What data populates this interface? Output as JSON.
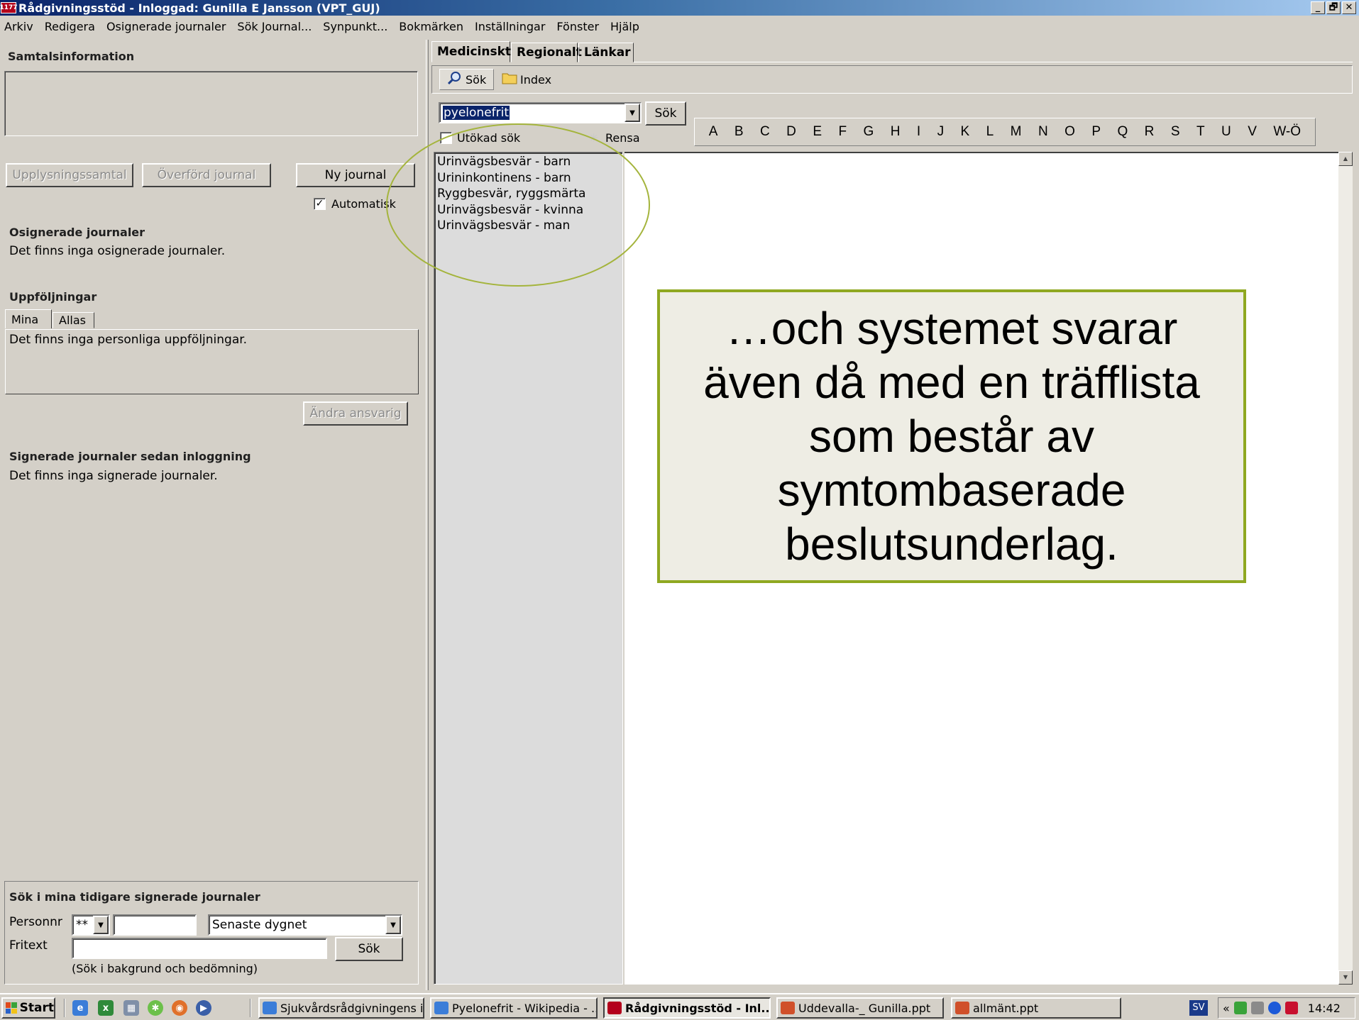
{
  "window": {
    "app_icon_text": "1177",
    "title": "Rådgivningsstöd - Inloggad: Gunilla E Jansson (VPT_GUJ)",
    "controls": [
      "_",
      "🗗",
      "✕"
    ]
  },
  "menubar": [
    "Arkiv",
    "Redigera",
    "Osignerade journaler",
    "Sök Journal...",
    "Synpunkt...",
    "Bokmärken",
    "Inställningar",
    "Fönster",
    "Hjälp"
  ],
  "left": {
    "call_info_title": "Samtalsinformation",
    "buttons": {
      "upplysning": "Upplysningssamtal",
      "overford": "Överförd journal",
      "ny_journal": "Ny journal"
    },
    "automatisk_label": "Automatisk",
    "automatisk_checked": "✓",
    "unsigned_title": "Osignerade journaler",
    "unsigned_text": "Det finns inga osignerade journaler.",
    "followups_title": "Uppföljningar",
    "followup_tabs": [
      "Mina",
      "Allas"
    ],
    "followups_text": "Det finns inga personliga uppföljningar.",
    "change_responsible": "Ändra ansvarig",
    "signed_title": "Signerade journaler sedan inloggning",
    "signed_text": "Det finns inga signerade journaler.",
    "search_box": {
      "title": "Sök i mina tidigare signerade journaler",
      "personnr_label": "Personnr",
      "personnr_prefix": "**",
      "period": "Senaste dygnet",
      "fritext_label": "Fritext",
      "search_button": "Sök",
      "hint": "(Sök i bakgrund och bedömning)"
    }
  },
  "right": {
    "tabs": [
      "Medicinskt",
      "Regionalt",
      "Länkar"
    ],
    "tool_search": "Sök",
    "tool_index": "Index",
    "search_value": "pyelonefrit",
    "search_button": "Sök",
    "extended_search": "Utökad sök",
    "clear": "Rensa",
    "alphabet": [
      "A",
      "B",
      "C",
      "D",
      "E",
      "F",
      "G",
      "H",
      "I",
      "J",
      "K",
      "L",
      "M",
      "N",
      "O",
      "P",
      "Q",
      "R",
      "S",
      "T",
      "U",
      "V",
      "W-Ö"
    ],
    "results": [
      "Urinvägsbesvär - barn",
      "Urininkontinens - barn",
      "Ryggbesvär, ryggsmärta",
      "Urinvägsbesvär - kvinna",
      "Urinvägsbesvär - man"
    ]
  },
  "callout": {
    "text": "…och systemet svarar även då med en träfflista som består av symtombaserade beslutsunderlag.",
    "border_color": "#8fa821"
  },
  "taskbar": {
    "start": "Start",
    "tasks": [
      {
        "label": "Sjukvårdsrådgivningens i...",
        "active": false
      },
      {
        "label": "Pyelonefrit - Wikipedia - ...",
        "active": false
      },
      {
        "label": "Rådgivningsstöd - Inl...",
        "active": true
      },
      {
        "label": "Uddevalla-_ Gunilla.ppt",
        "active": false
      },
      {
        "label": "allmänt.ppt",
        "active": false
      }
    ],
    "lang": "SV",
    "tray_chevron": "«",
    "clock": "14:42"
  }
}
